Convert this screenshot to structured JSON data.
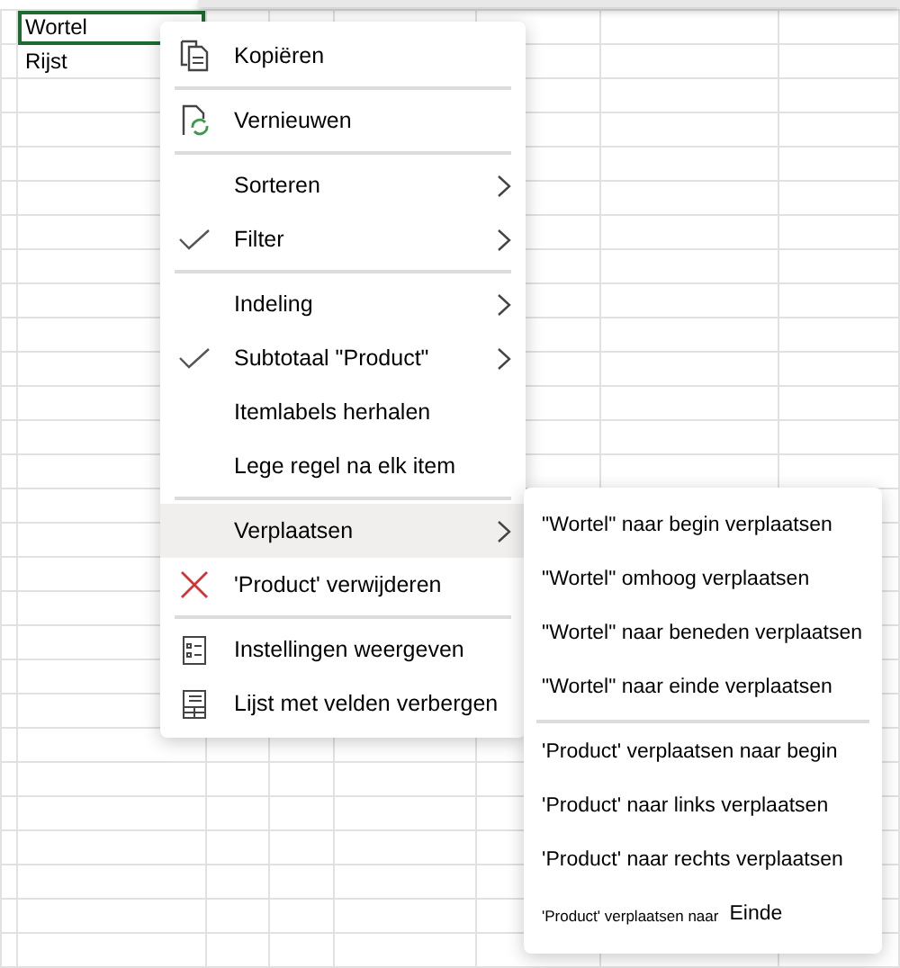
{
  "cells": [
    {
      "text": "Wortel",
      "selected": true
    },
    {
      "text": "Rijst",
      "selected": false
    }
  ],
  "context_menu": {
    "items": [
      {
        "kind": "item",
        "label": "Kopiëren",
        "checked": false,
        "submenu": false,
        "selected": false
      },
      {
        "kind": "separator"
      },
      {
        "kind": "item",
        "label": "Vernieuwen",
        "checked": false,
        "submenu": false,
        "selected": false
      },
      {
        "kind": "separator"
      },
      {
        "kind": "item",
        "label": "Sorteren",
        "checked": false,
        "submenu": true,
        "selected": false
      },
      {
        "kind": "item",
        "label": "Filter",
        "checked": true,
        "submenu": true,
        "selected": false
      },
      {
        "kind": "separator"
      },
      {
        "kind": "item",
        "label": "Indeling",
        "checked": false,
        "submenu": true,
        "selected": false
      },
      {
        "kind": "item",
        "label": "Subtotaal \"Product\"",
        "checked": true,
        "submenu": true,
        "selected": false
      },
      {
        "kind": "item",
        "label": "Itemlabels herhalen",
        "checked": false,
        "submenu": false,
        "selected": false
      },
      {
        "kind": "item",
        "label": "Lege regel na elk item",
        "checked": false,
        "submenu": false,
        "selected": false
      },
      {
        "kind": "separator"
      },
      {
        "kind": "item",
        "label": "Verplaatsen",
        "checked": false,
        "submenu": true,
        "selected": true
      },
      {
        "kind": "item",
        "label": "'Product' verwijderen",
        "checked": false,
        "submenu": false,
        "selected": false
      },
      {
        "kind": "separator"
      },
      {
        "kind": "item",
        "label": "Instellingen weergeven",
        "checked": false,
        "submenu": false,
        "selected": false
      },
      {
        "kind": "item",
        "label": "Lijst met velden verbergen",
        "checked": false,
        "submenu": false,
        "selected": false
      }
    ]
  },
  "submenu": {
    "items": [
      {
        "kind": "item",
        "label": "\"Wortel\" naar begin verplaatsen"
      },
      {
        "kind": "item",
        "label": "\"Wortel\" omhoog verplaatsen"
      },
      {
        "kind": "item",
        "label": "\"Wortel\" naar beneden verplaatsen"
      },
      {
        "kind": "item",
        "label": "\"Wortel\" naar einde verplaatsen"
      },
      {
        "kind": "separator"
      },
      {
        "kind": "item",
        "label": "'Product' verplaatsen naar begin"
      },
      {
        "kind": "item",
        "label": "'Product' naar links verplaatsen"
      },
      {
        "kind": "item",
        "label": "'Product' naar rechts verplaatsen"
      },
      {
        "kind": "split",
        "label": "'Product' verplaatsen naar",
        "value": "Einde"
      }
    ]
  }
}
